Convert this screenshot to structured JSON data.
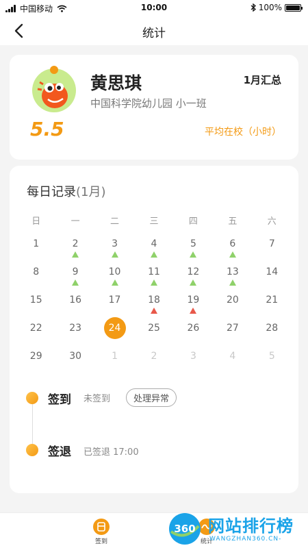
{
  "status_bar": {
    "carrier": "中国移动",
    "time": "10:00",
    "battery": "100%"
  },
  "nav": {
    "title": "统计"
  },
  "profile": {
    "name": "黄思琪",
    "school": "中国科学院幼儿园 小一班",
    "summary": "1月汇总",
    "average_hours": "5.5",
    "average_label": "平均在校（小时）"
  },
  "records": {
    "title": "每日记录",
    "month": "(1月)",
    "weekdays": [
      "日",
      "一",
      "二",
      "三",
      "四",
      "五",
      "六"
    ],
    "weeks": [
      [
        {
          "d": "1"
        },
        {
          "d": "2",
          "mark": "green"
        },
        {
          "d": "3",
          "mark": "green"
        },
        {
          "d": "4",
          "mark": "green"
        },
        {
          "d": "5",
          "mark": "green"
        },
        {
          "d": "6",
          "mark": "green"
        },
        {
          "d": "7"
        }
      ],
      [
        {
          "d": "8"
        },
        {
          "d": "9",
          "mark": "green"
        },
        {
          "d": "10",
          "mark": "green"
        },
        {
          "d": "11",
          "mark": "green"
        },
        {
          "d": "12",
          "mark": "green"
        },
        {
          "d": "13",
          "mark": "green"
        },
        {
          "d": "14"
        }
      ],
      [
        {
          "d": "15"
        },
        {
          "d": "16"
        },
        {
          "d": "17"
        },
        {
          "d": "18",
          "mark": "red"
        },
        {
          "d": "19",
          "mark": "red"
        },
        {
          "d": "20"
        },
        {
          "d": "21"
        }
      ],
      [
        {
          "d": "22"
        },
        {
          "d": "23"
        },
        {
          "d": "24",
          "today": true
        },
        {
          "d": "25"
        },
        {
          "d": "26"
        },
        {
          "d": "27"
        },
        {
          "d": "28"
        }
      ],
      [
        {
          "d": "29"
        },
        {
          "d": "30"
        },
        {
          "d": "1",
          "other": true
        },
        {
          "d": "2",
          "other": true
        },
        {
          "d": "3",
          "other": true
        },
        {
          "d": "4",
          "other": true
        },
        {
          "d": "5",
          "other": true
        }
      ]
    ]
  },
  "timeline": {
    "sign_in": {
      "label": "签到",
      "status": "未签到",
      "action": "处理异常"
    },
    "sign_out": {
      "label": "签退",
      "status": "已签退 17:00"
    }
  },
  "tabbar": {
    "tabs": [
      {
        "label": "签到"
      },
      {
        "label": "统计"
      }
    ]
  },
  "watermark": {
    "text": "网站排行榜",
    "sub": "WANGZHAN360.CN-",
    "logo_text": "360"
  },
  "colors": {
    "accent": "#f39a14",
    "green_mark": "#8fd16a",
    "red_mark": "#e8584a"
  }
}
